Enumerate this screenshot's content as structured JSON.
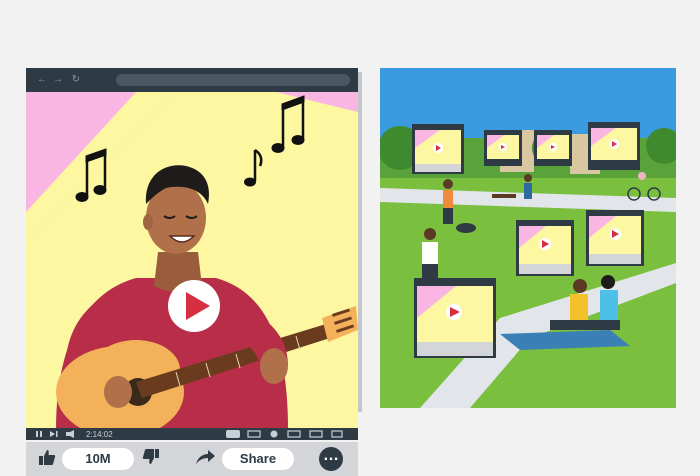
{
  "player": {
    "time": "2:14:02",
    "views": "10M",
    "share_label": "Share",
    "icons": {
      "back": "arrow-left-icon",
      "forward": "arrow-right-icon",
      "reload": "reload-icon",
      "like": "thumbs-up-icon",
      "dislike": "thumbs-down-icon",
      "share": "share-arrow-icon",
      "more": "more-dots-icon",
      "play": "play-icon"
    },
    "colors": {
      "window_frame": "#2e3a44",
      "background_pink": "#f9b6e3",
      "spotlight_yellow": "#fcf7a0",
      "play_red": "#d62f3f",
      "shirt_red": "#b82e48",
      "guitar": "#f3b25a"
    }
  },
  "scene": {
    "colors": {
      "sky": "#3b9be0",
      "grass": "#7bbf3e",
      "path": "#e2e6ea"
    }
  }
}
